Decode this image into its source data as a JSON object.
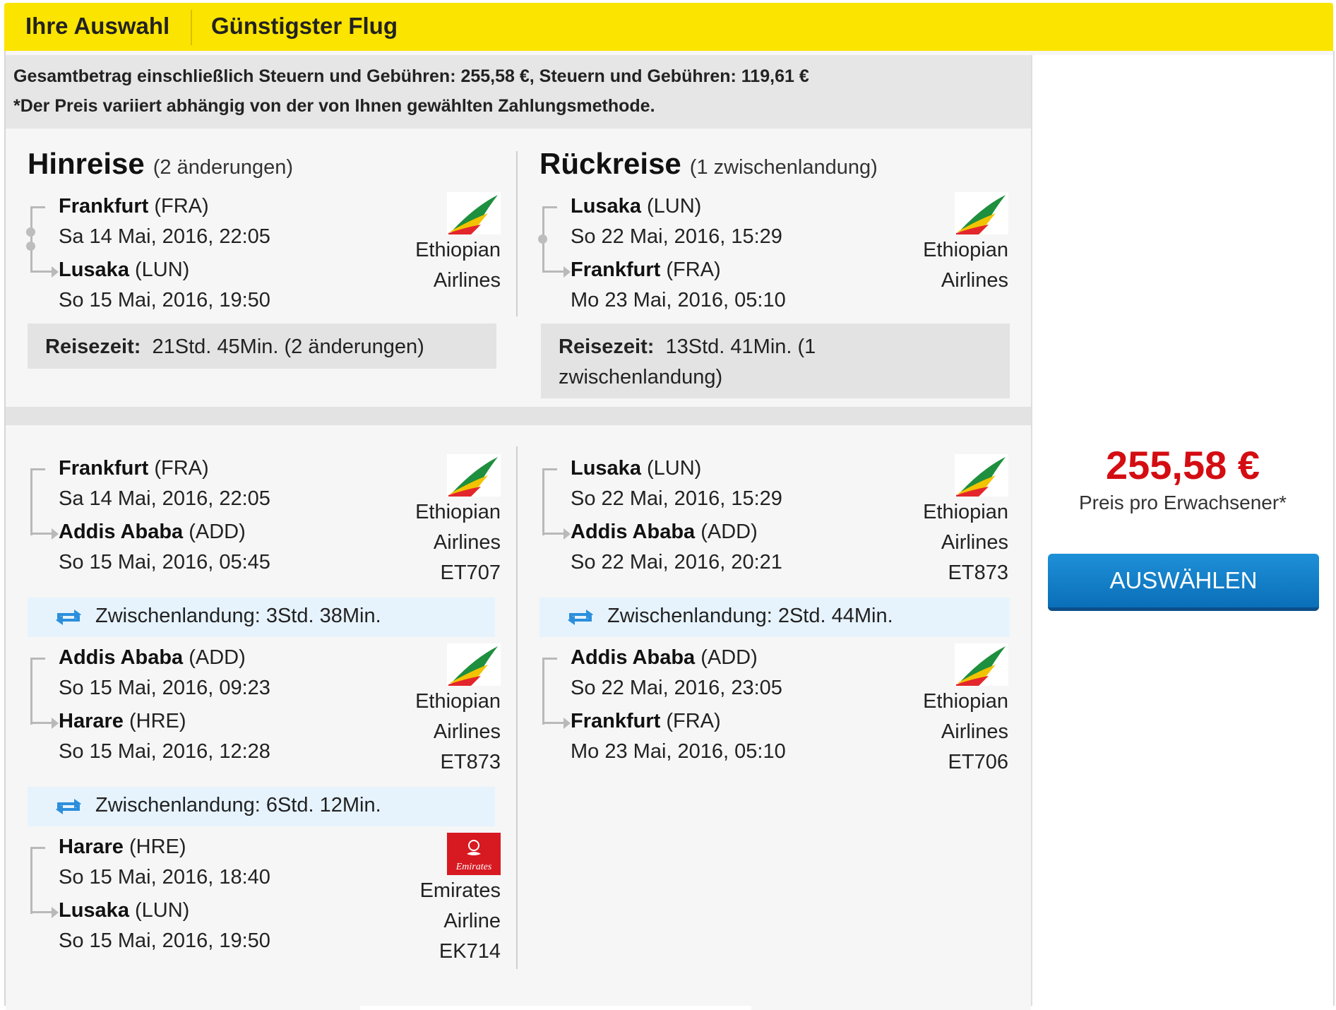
{
  "header": {
    "tab_selection": "Ihre Auswahl",
    "tab_cheapest": "Günstigster Flug"
  },
  "price_info": {
    "total_line": "Gesamtbetrag einschließlich Steuern und Gebühren: 255,58 €, Steuern und Gebühren: 119,61 €",
    "note_line": "*Der Preis variiert abhängig von der von Ihnen gewählten Zahlungsmethode."
  },
  "outbound": {
    "title": "Hinreise",
    "subtitle": "(2 änderungen)",
    "from_city": "Frankfurt",
    "from_code": "(FRA)",
    "from_date": "Sa 14 Mai, 2016, 22:05",
    "to_city": "Lusaka",
    "to_code": "(LUN)",
    "to_date": "So 15 Mai, 2016, 19:50",
    "airline_line1": "Ethiopian",
    "airline_line2": "Airlines",
    "travel_label": "Reisezeit:",
    "travel_value": "21Std. 45Min. (2 änderungen)"
  },
  "return": {
    "title": "Rückreise",
    "subtitle": "(1 zwischenlandung)",
    "from_city": "Lusaka",
    "from_code": "(LUN)",
    "from_date": "So 22 Mai, 2016, 15:29",
    "to_city": "Frankfurt",
    "to_code": "(FRA)",
    "to_date": "Mo 23 Mai, 2016, 05:10",
    "airline_line1": "Ethiopian",
    "airline_line2": "Airlines",
    "travel_label": "Reisezeit:",
    "travel_value_1": "13Std. 41Min. (1",
    "travel_value_2": "zwischenlandung)"
  },
  "outbound_segments": [
    {
      "from_city": "Frankfurt",
      "from_code": "(FRA)",
      "from_date": "Sa 14 Mai, 2016, 22:05",
      "to_city": "Addis Ababa",
      "to_code": "(ADD)",
      "to_date": "So 15 Mai, 2016, 05:45",
      "airline_line1": "Ethiopian",
      "airline_line2": "Airlines",
      "flight": "ET707",
      "logo": "ethiopian-logo"
    },
    {
      "from_city": "Addis Ababa",
      "from_code": "(ADD)",
      "from_date": "So 15 Mai, 2016, 09:23",
      "to_city": "Harare",
      "to_code": "(HRE)",
      "to_date": "So 15 Mai, 2016, 12:28",
      "airline_line1": "Ethiopian",
      "airline_line2": "Airlines",
      "flight": "ET873",
      "logo": "ethiopian-logo"
    },
    {
      "from_city": "Harare",
      "from_code": "(HRE)",
      "from_date": "So 15 Mai, 2016, 18:40",
      "to_city": "Lusaka",
      "to_code": "(LUN)",
      "to_date": "So 15 Mai, 2016, 19:50",
      "airline_line1": "Emirates",
      "airline_line2": "Airline",
      "flight": "EK714",
      "logo": "emirates-logo"
    }
  ],
  "outbound_stopovers": [
    "Zwischenlandung: 3Std. 38Min.",
    "Zwischenlandung: 6Std. 12Min."
  ],
  "return_segments": [
    {
      "from_city": "Lusaka",
      "from_code": "(LUN)",
      "from_date": "So 22 Mai, 2016, 15:29",
      "to_city": "Addis Ababa",
      "to_code": "(ADD)",
      "to_date": "So 22 Mai, 2016, 20:21",
      "airline_line1": "Ethiopian",
      "airline_line2": "Airlines",
      "flight": "ET873",
      "logo": "ethiopian-logo"
    },
    {
      "from_city": "Addis Ababa",
      "from_code": "(ADD)",
      "from_date": "So 22 Mai, 2016, 23:05",
      "to_city": "Frankfurt",
      "to_code": "(FRA)",
      "to_date": "Mo 23 Mai, 2016, 05:10",
      "airline_line1": "Ethiopian",
      "airline_line2": "Airlines",
      "flight": "ET706",
      "logo": "ethiopian-logo"
    }
  ],
  "return_stopovers": [
    "Zwischenlandung: 2Std. 44Min."
  ],
  "offer": {
    "price": "255,58 €",
    "price_label": "Preis pro Erwachsener*",
    "select_label": "AUSWÄHLEN"
  },
  "colors": {
    "header_bg": "#fbe400",
    "price_red": "#d40d12",
    "button_blue": "#0a6fb8",
    "stopover_bg": "#e6f3fd"
  }
}
